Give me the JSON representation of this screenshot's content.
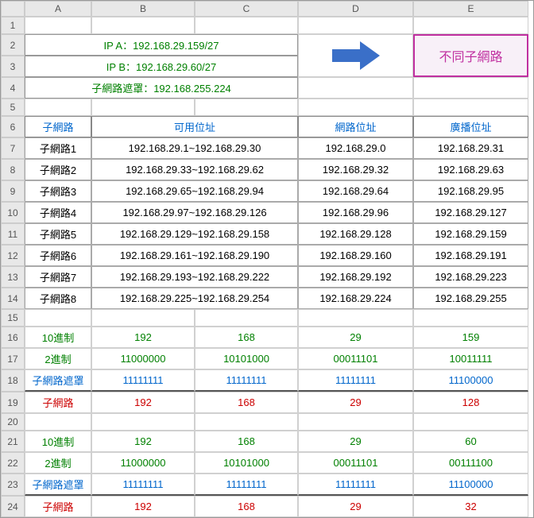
{
  "columns": [
    "A",
    "B",
    "C",
    "D",
    "E"
  ],
  "rows_count": 24,
  "ip_info": {
    "ip_a": "IP A：192.168.29.159/27",
    "ip_b": "IP B：192.168.29.60/27",
    "mask": "子網路遮罩：192.168.255.224"
  },
  "result_box": "不同子網路",
  "table_headers": {
    "subnet": "子網路",
    "usable": "可用位址",
    "network": "網路位址",
    "broadcast": "廣播位址"
  },
  "subnets": [
    {
      "name": "子網路1",
      "range": "192.168.29.1~192.168.29.30",
      "net": "192.168.29.0",
      "bcast": "192.168.29.31"
    },
    {
      "name": "子網路2",
      "range": "192.168.29.33~192.168.29.62",
      "net": "192.168.29.32",
      "bcast": "192.168.29.63"
    },
    {
      "name": "子網路3",
      "range": "192.168.29.65~192.168.29.94",
      "net": "192.168.29.64",
      "bcast": "192.168.29.95"
    },
    {
      "name": "子網路4",
      "range": "192.168.29.97~192.168.29.126",
      "net": "192.168.29.96",
      "bcast": "192.168.29.127"
    },
    {
      "name": "子網路5",
      "range": "192.168.29.129~192.168.29.158",
      "net": "192.168.29.128",
      "bcast": "192.168.29.159"
    },
    {
      "name": "子網路6",
      "range": "192.168.29.161~192.168.29.190",
      "net": "192.168.29.160",
      "bcast": "192.168.29.191"
    },
    {
      "name": "子網路7",
      "range": "192.168.29.193~192.168.29.222",
      "net": "192.168.29.192",
      "bcast": "192.168.29.223"
    },
    {
      "name": "子網路8",
      "range": "192.168.29.225~192.168.29.254",
      "net": "192.168.29.224",
      "bcast": "192.168.29.255"
    }
  ],
  "calc_labels": {
    "dec": "10進制",
    "bin": "2進制",
    "mask": "子網路遮罩",
    "subnet": "子網路"
  },
  "calc1": {
    "dec": [
      "192",
      "168",
      "29",
      "159"
    ],
    "bin": [
      "11000000",
      "10101000",
      "00011101",
      "10011111"
    ],
    "mask": [
      "11111111",
      "11111111",
      "11111111",
      "11100000"
    ],
    "subnet": [
      "192",
      "168",
      "29",
      "128"
    ]
  },
  "calc2": {
    "dec": [
      "192",
      "168",
      "29",
      "60"
    ],
    "bin": [
      "11000000",
      "10101000",
      "00011101",
      "00111100"
    ],
    "mask": [
      "11111111",
      "11111111",
      "11111111",
      "11100000"
    ],
    "subnet": [
      "192",
      "168",
      "29",
      "32"
    ]
  },
  "chart_data": [
    {
      "type": "table",
      "title": "Subnet table",
      "columns": [
        "子網路",
        "可用位址",
        "網路位址",
        "廣播位址"
      ],
      "rows": [
        [
          "子網路1",
          "192.168.29.1~192.168.29.30",
          "192.168.29.0",
          "192.168.29.31"
        ],
        [
          "子網路2",
          "192.168.29.33~192.168.29.62",
          "192.168.29.32",
          "192.168.29.63"
        ],
        [
          "子網路3",
          "192.168.29.65~192.168.29.94",
          "192.168.29.64",
          "192.168.29.95"
        ],
        [
          "子網路4",
          "192.168.29.97~192.168.29.126",
          "192.168.29.96",
          "192.168.29.127"
        ],
        [
          "子網路5",
          "192.168.29.129~192.168.29.158",
          "192.168.29.128",
          "192.168.29.159"
        ],
        [
          "子網路6",
          "192.168.29.161~192.168.29.190",
          "192.168.29.160",
          "192.168.29.191"
        ],
        [
          "子網路7",
          "192.168.29.193~192.168.29.222",
          "192.168.29.192",
          "192.168.29.223"
        ],
        [
          "子網路8",
          "192.168.29.225~192.168.29.254",
          "192.168.29.224",
          "192.168.29.255"
        ]
      ]
    }
  ]
}
